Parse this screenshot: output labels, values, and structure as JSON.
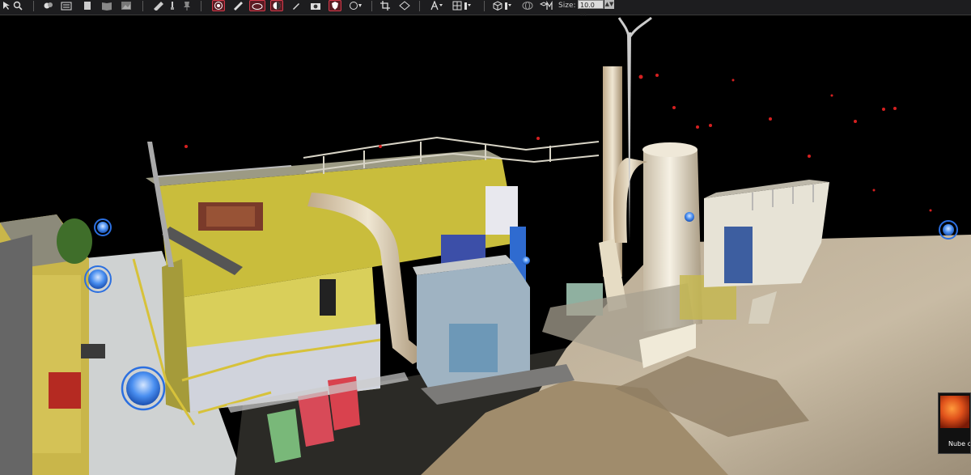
{
  "toolbar": {
    "size_label": "Size:",
    "size_value": "10.0 m",
    "icons": [
      "select-icon",
      "zoom-icon",
      "layers-icon",
      "list-icon",
      "page-icon",
      "book-icon",
      "image-icon",
      "ruler-icon",
      "brush-icon",
      "pin-icon",
      "target-icon",
      "measure-icon",
      "cloud-icon",
      "visibility-icon",
      "pencil-icon",
      "camera-icon",
      "shield-icon",
      "filter-icon",
      "crop-icon",
      "perspective-icon",
      "text-icon",
      "grid-icon",
      "cube-icon",
      "globe-icon",
      "model-icon"
    ],
    "accent_color": "#d13a4a"
  },
  "viewport": {
    "scene": "point-cloud-industrial-plant",
    "station_markers": 6
  },
  "thumbnail": {
    "label": "Nube c"
  }
}
